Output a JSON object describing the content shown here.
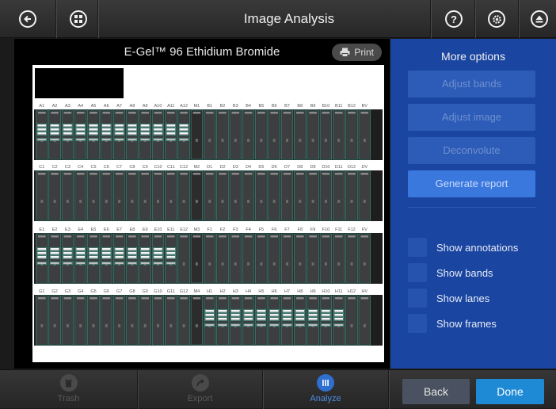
{
  "header": {
    "title": "Image Analysis",
    "back_icon": "arrow-left-circle-icon",
    "grid_icon": "grid-circle-icon",
    "help_icon": "question-circle-icon",
    "settings_icon": "gear-circle-icon",
    "eject_icon": "eject-circle-icon",
    "help_glyph": "?",
    "settings_glyph": "⚙",
    "eject_glyph": "⏏",
    "back_glyph": "←"
  },
  "gel": {
    "title": "E-Gel™ 96 Ethidium Bromide",
    "print_label": "Print",
    "rows": [
      {
        "labels": [
          "A1",
          "A2",
          "A3",
          "A4",
          "A5",
          "A6",
          "A7",
          "A8",
          "A9",
          "A10",
          "A11",
          "A12",
          "M1",
          "B1",
          "B2",
          "B3",
          "B4",
          "B5",
          "B6",
          "B7",
          "B8",
          "B9",
          "B10",
          "B11",
          "B12",
          "BV"
        ],
        "band_lanes": [
          1,
          2,
          3,
          4,
          5,
          6,
          7,
          8,
          9,
          10,
          11,
          12
        ]
      },
      {
        "labels": [
          "C1",
          "C2",
          "C3",
          "C4",
          "C5",
          "C6",
          "C7",
          "C8",
          "C9",
          "C10",
          "C11",
          "C12",
          "M2",
          "D1",
          "D2",
          "D3",
          "D4",
          "D5",
          "D6",
          "D7",
          "D8",
          "D9",
          "D10",
          "D11",
          "D12",
          "DV"
        ],
        "band_lanes": []
      },
      {
        "labels": [
          "E1",
          "E2",
          "E3",
          "E4",
          "E5",
          "E6",
          "E7",
          "E8",
          "E9",
          "E10",
          "E11",
          "E12",
          "M3",
          "F1",
          "F2",
          "F3",
          "F4",
          "F5",
          "F6",
          "F7",
          "F8",
          "F9",
          "F10",
          "F11",
          "F12",
          "FV"
        ],
        "band_lanes": [
          1,
          2,
          3,
          4,
          5,
          6,
          7,
          8,
          9,
          10,
          11
        ]
      },
      {
        "labels": [
          "G1",
          "G2",
          "G3",
          "G4",
          "G5",
          "G6",
          "G7",
          "G8",
          "G9",
          "G10",
          "G11",
          "G12",
          "M4",
          "H1",
          "H2",
          "H3",
          "H4",
          "H5",
          "H6",
          "H7",
          "H8",
          "H9",
          "H10",
          "H11",
          "H12",
          "HV"
        ],
        "band_lanes": [
          14,
          15,
          16,
          17,
          18,
          19,
          20,
          21,
          22,
          23,
          24
        ]
      }
    ]
  },
  "options": {
    "title": "More options",
    "adjust_bands": "Adjust bands",
    "adjust_image": "Adjust image",
    "deconvolute": "Deconvolute",
    "generate_report": "Generate report",
    "show_annotations": "Show annotations",
    "show_bands": "Show bands",
    "show_lanes": "Show lanes",
    "show_frames": "Show frames"
  },
  "bottom": {
    "trash_label": "Trash",
    "export_label": "Export",
    "analyze_label": "Analyze",
    "back_label": "Back",
    "done_label": "Done",
    "trash_icon": "trash-icon",
    "export_icon": "export-arrow-icon",
    "analyze_icon": "analyze-grid-icon"
  },
  "colors": {
    "accent_blue": "#1a45a0",
    "done_blue": "#1e8ad6",
    "band_teal": "#4fb9a8"
  }
}
